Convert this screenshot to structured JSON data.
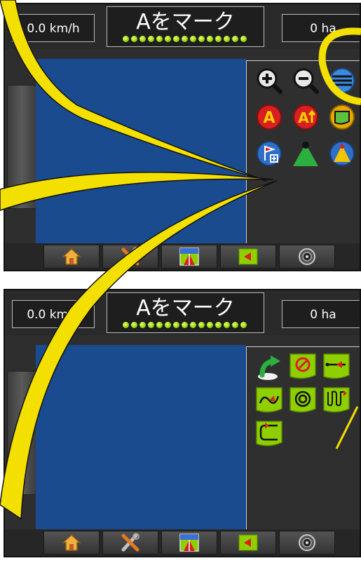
{
  "screens": [
    {
      "speed": "0.0 km/h",
      "title": "Aをマーク",
      "area": "0 ha",
      "menu_icons": [
        "zoom-in-icon",
        "zoom-out-icon",
        "guidance-lines-icon",
        "mark-a-icon",
        "mark-a-plus-icon",
        "boundary-icon",
        "add-marker-icon",
        "lightbar-green-icon",
        "lightbar-yellow-icon"
      ]
    },
    {
      "speed": "0.0 km/h",
      "title": "Aをマーク",
      "area": "0 ha",
      "menu_icons": [
        "return-to-point-icon",
        "no-guidance-icon",
        "straight-ab-icon",
        "curve-ab-icon",
        "circle-pivot-icon",
        "adaptive-curve-icon",
        "last-pass-icon"
      ]
    }
  ],
  "bottom_nav": [
    "home-icon",
    "tools-icon",
    "guidance-view-icon",
    "vehicle-view-icon",
    "camera-icon"
  ],
  "colors": {
    "map": "#1a4b8f",
    "callout": "#f4e000",
    "accent_green": "#8fcf00"
  }
}
